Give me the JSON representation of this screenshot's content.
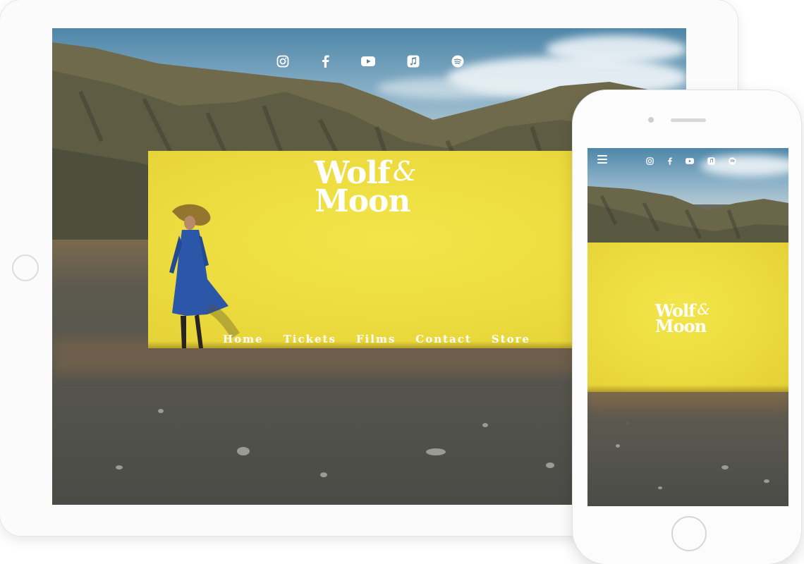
{
  "brand": {
    "line1": "Wolf",
    "amp": "&",
    "line2": "Moon"
  },
  "social_icons": [
    "instagram-icon",
    "facebook-icon",
    "youtube-icon",
    "music-icon",
    "spotify-icon"
  ],
  "nav": {
    "items": [
      "Home",
      "Tickets",
      "Films",
      "Contact",
      "Store"
    ]
  },
  "colors": {
    "wall_yellow": "#ecdb3e",
    "dress_blue": "#2c56a8",
    "text_white": "#ffffff",
    "device_frame": "#fbfbfb"
  }
}
